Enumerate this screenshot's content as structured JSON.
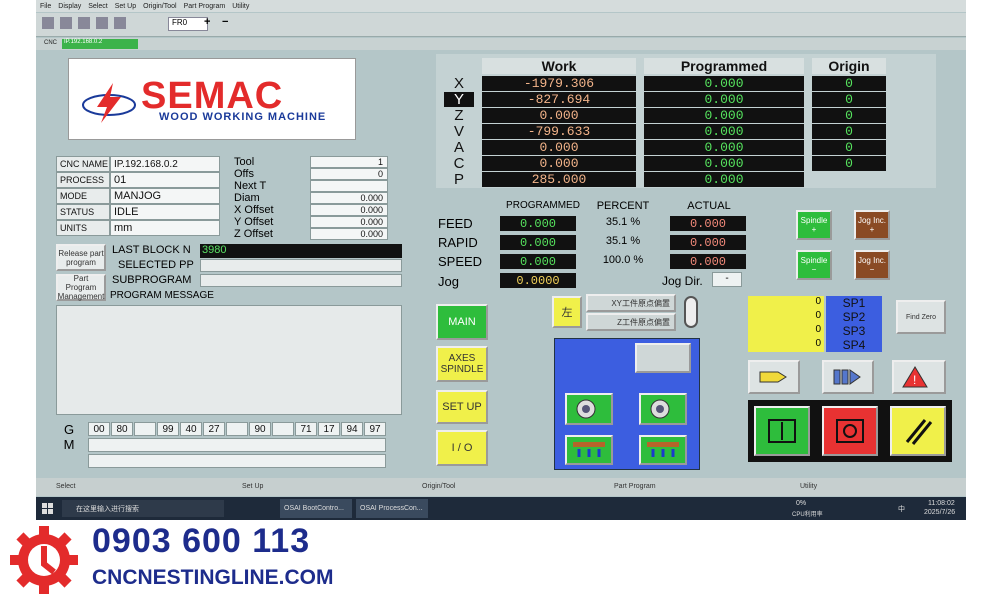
{
  "menu": [
    "File",
    "Display",
    "Select",
    "Set Up",
    "Origin/Tool",
    "Part Program",
    "Utility"
  ],
  "toolbar": {
    "feed_mode": "FR0",
    "plus": "+",
    "minus": "−"
  },
  "cncbar": {
    "label": "CNC",
    "address": "IP.192.168.0.2"
  },
  "logo": {
    "brand": "SEMAC",
    "tagline": "WOOD WORKING MACHINE"
  },
  "status": {
    "rows": [
      {
        "label": "CNC NAME",
        "value": "IP.192.168.0.2"
      },
      {
        "label": "PROCESS",
        "value": "01"
      },
      {
        "label": "MODE",
        "value": "MANJOG"
      },
      {
        "label": "STATUS",
        "value": "IDLE"
      },
      {
        "label": "UNITS",
        "value": "mm"
      }
    ]
  },
  "tool": {
    "rows": [
      {
        "label": "Tool",
        "value": "1"
      },
      {
        "label": "Offs",
        "value": "0"
      },
      {
        "label": "Next T",
        "value": ""
      },
      {
        "label": "Diam",
        "value": "0.000"
      },
      {
        "label": "X Offset",
        "value": "0.000"
      },
      {
        "label": "Y Offset",
        "value": "0.000"
      },
      {
        "label": "Z Offset",
        "value": "0.000"
      }
    ]
  },
  "program": {
    "release_label": "Release part program",
    "last_block_label": "LAST BLOCK N",
    "last_block_value": "3980",
    "selected_pp_label": "SELECTED PP",
    "pp_mgmt_label": "Part Program Management",
    "subprogram_label": "SUBPROGRAM",
    "message_label": "PROGRAM MESSAGE"
  },
  "gcodes": {
    "g_label": "G",
    "m_label": "M",
    "values": [
      "00",
      "80",
      "",
      "99",
      "40",
      "27",
      "",
      "90",
      "",
      "71",
      "17",
      "94",
      "97"
    ]
  },
  "axes": {
    "headers": {
      "work": "Work",
      "programmed": "Programmed",
      "origin": "Origin"
    },
    "rows": [
      {
        "axis": "X",
        "work": "-1979.306",
        "programmed": "0.000",
        "origin": "0"
      },
      {
        "axis": "Y",
        "work": "-827.694",
        "programmed": "0.000",
        "origin": "0"
      },
      {
        "axis": "Z",
        "work": "0.000",
        "programmed": "0.000",
        "origin": "0"
      },
      {
        "axis": "V",
        "work": "-799.633",
        "programmed": "0.000",
        "origin": "0"
      },
      {
        "axis": "A",
        "work": "0.000",
        "programmed": "0.000",
        "origin": "0"
      },
      {
        "axis": "C",
        "work": "0.000",
        "programmed": "0.000",
        "origin": "0"
      },
      {
        "axis": "P",
        "work": "285.000",
        "programmed": "0.000",
        "origin": ""
      }
    ]
  },
  "feeds": {
    "headers": {
      "programmed": "PROGRAMMED",
      "percent": "PERCENT",
      "actual": "ACTUAL"
    },
    "rows": [
      {
        "label": "FEED",
        "programmed": "0.000",
        "percent": "35.1 %",
        "actual": "0.000"
      },
      {
        "label": "RAPID",
        "programmed": "0.000",
        "percent": "35.1 %",
        "actual": "0.000"
      },
      {
        "label": "SPEED",
        "programmed": "0.000",
        "percent": "100.0 %",
        "actual": "0.000"
      }
    ],
    "jog_label": "Jog",
    "jog_value": "0.0000",
    "jog_dir_label": "Jog Dir.",
    "jog_dir_value": "-"
  },
  "spindle_buttons": {
    "spindle_plus": "Spindle +",
    "spindle_minus": "Spindle −",
    "jog_inc_plus": "Jog Inc. +",
    "jog_inc_minus": "Jog Inc. −"
  },
  "menu_buttons": {
    "main": "MAIN",
    "axes_spindle": "AXES SPINDLE",
    "setup": "SET UP",
    "io": "I / O"
  },
  "origin_buttons": {
    "left": "左",
    "xy": "XY工件原点偏置",
    "z": "Z工件原点偏置"
  },
  "sp": {
    "rows": [
      {
        "val": "0",
        "name": "SP1"
      },
      {
        "val": "0",
        "name": "SP2"
      },
      {
        "val": "0",
        "name": "SP3"
      },
      {
        "val": "0",
        "name": "SP4"
      }
    ]
  },
  "find_zero": "Find Zero",
  "statusbar": {
    "select": "Select",
    "setup": "Set Up",
    "origin": "Origin/Tool",
    "part": "Part Program",
    "utility": "Utility"
  },
  "taskbar": {
    "search": "在这里输入进行搜索",
    "app1": "OSAI BootContro...",
    "app2": "OSAI ProcessCon...",
    "cpu": "0%",
    "cpu_label": "CPU利用率",
    "lang": "中",
    "time": "11:08:02",
    "date": "2025/7/26"
  },
  "watermark": {
    "phone": "0903 600 113",
    "site": "CNCNESTINGLINE.COM"
  },
  "colors": {
    "green_btn": "#2ebd3c",
    "brown_btn": "#8a4a24",
    "yellow_btn": "#f0f04a",
    "blue_panel": "#3c5ee0",
    "red": "#e83232",
    "lcd_bg": "#111111"
  }
}
